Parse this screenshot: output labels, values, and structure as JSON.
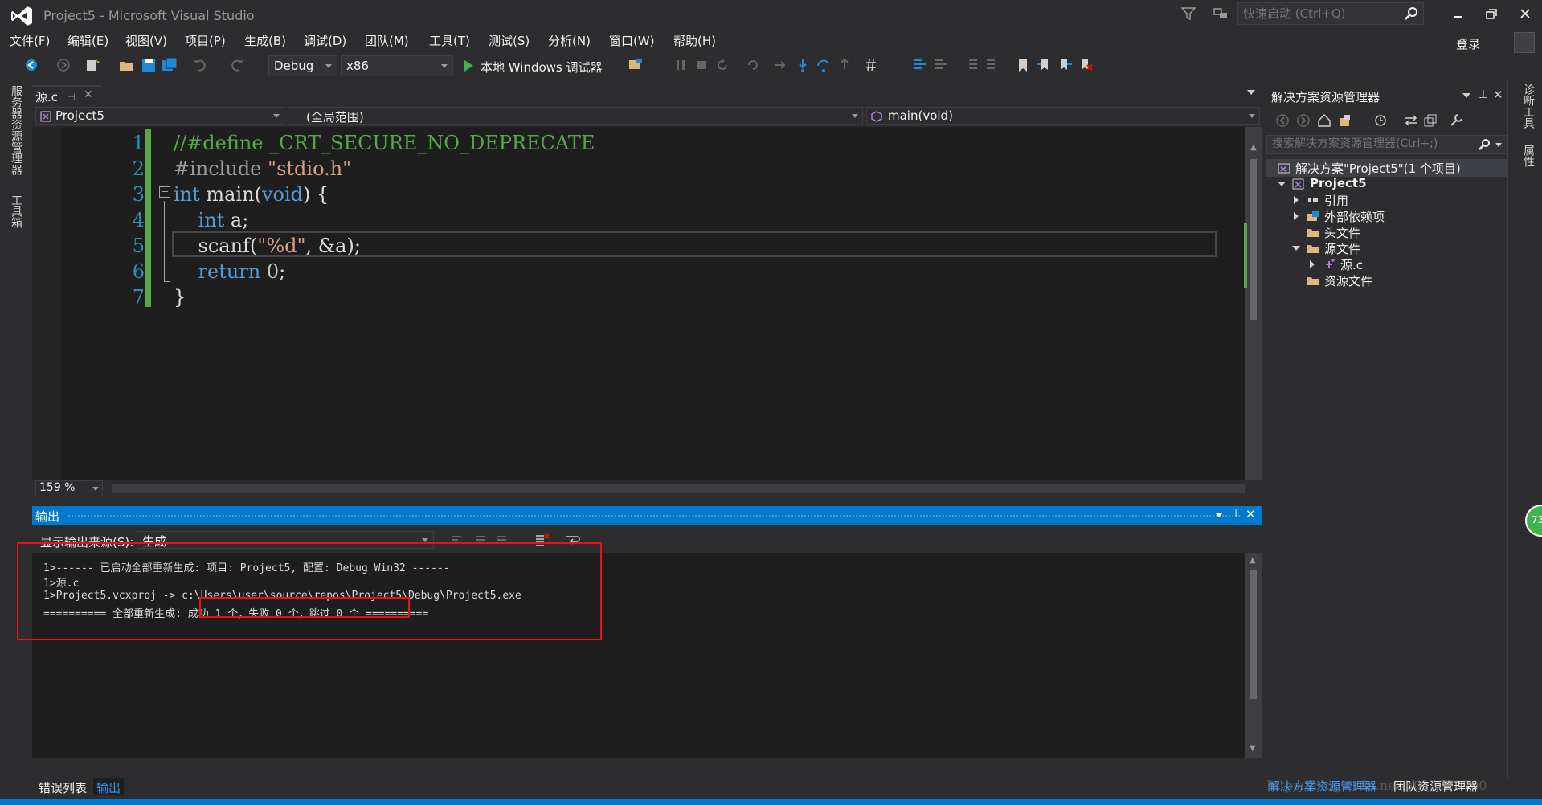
{
  "window": {
    "title": "Project5 - Microsoft Visual Studio",
    "quick_launch_placeholder": "快速启动 (Ctrl+Q)",
    "login": "登录"
  },
  "menu": [
    "文件(F)",
    "编辑(E)",
    "视图(V)",
    "项目(P)",
    "生成(B)",
    "调试(D)",
    "团队(M)",
    "工具(T)",
    "测试(S)",
    "分析(N)",
    "窗口(W)",
    "帮助(H)"
  ],
  "toolbar": {
    "configuration": "Debug",
    "platform": "x86",
    "run_label": "本地 Windows 调试器"
  },
  "left_sidebar": [
    "服务器资源管理器",
    "工具箱"
  ],
  "right_sidebar": [
    "诊断工具",
    "属性"
  ],
  "editor": {
    "tab_label": "源.c",
    "nav_project": "Project5",
    "nav_scope": "(全局范围)",
    "nav_member": "main(void)",
    "line_numbers": [
      "1",
      "2",
      "3",
      "4",
      "5",
      "6",
      "7"
    ],
    "zoom": "159 %"
  },
  "output": {
    "title": "输出",
    "source_label": "显示输出来源(S):",
    "source_value": "生成",
    "lines": [
      "1>------ 已启动全部重新生成: 项目: Project5, 配置: Debug Win32 ------",
      "1>源.c",
      "1>Project5.vcxproj -> c:\\Users\\user\\source\\repos\\Project5\\Debug\\Project5.exe",
      "========== 全部重新生成: 成功 1 个，失败 0 个，跳过 0 个 =========="
    ]
  },
  "bottom_tabs": [
    "错误列表",
    "输出"
  ],
  "solution_explorer": {
    "title": "解决方案资源管理器",
    "search_placeholder": "搜索解决方案资源管理器(Ctrl+;)",
    "tree": {
      "solution": "解决方案\"Project5\"(1 个项目)",
      "project": "Project5",
      "references": "引用",
      "external_deps": "外部依赖项",
      "headers": "头文件",
      "sources": "源文件",
      "source_file": "源.c",
      "resources": "资源文件"
    },
    "bottom_tabs": [
      "解决方案资源管理器",
      "团队资源管理器"
    ]
  },
  "watermark": "https://blog.csdn.net/u015370790",
  "badge": "73",
  "colors": {
    "accent": "#007acc",
    "keyword": "#569cd6",
    "comment": "#57a64a",
    "string": "#d69d85",
    "line_number": "#2b91af",
    "highlight_box": "#e11111"
  }
}
